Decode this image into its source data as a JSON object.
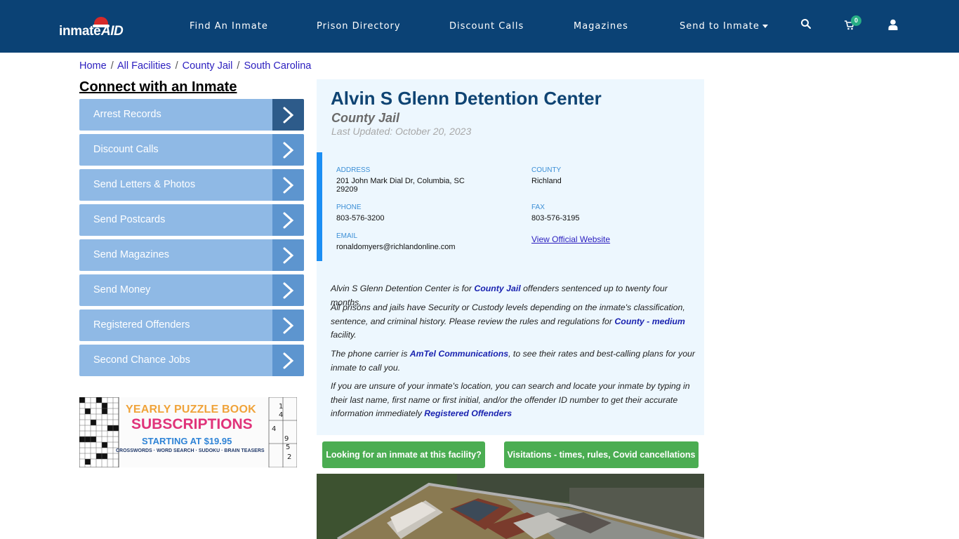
{
  "header": {
    "logo_text_1": "inmate",
    "logo_text_2": "AID",
    "nav": [
      {
        "label": "Find An Inmate"
      },
      {
        "label": "Prison Directory"
      },
      {
        "label": "Discount Calls"
      },
      {
        "label": "Magazines"
      },
      {
        "label": "Send to Inmate"
      }
    ],
    "cart_count": "0",
    "icons": [
      "search-icon",
      "cart-icon",
      "user-icon"
    ]
  },
  "breadcrumb": [
    {
      "label": "Home"
    },
    {
      "label": "All Facilities"
    },
    {
      "label": "County Jail"
    },
    {
      "label": "South Carolina"
    }
  ],
  "breadcrumb_sep": "/",
  "sidebar": {
    "title": "Connect with an Inmate",
    "items": [
      {
        "label": "Arrest Records"
      },
      {
        "label": "Discount Calls"
      },
      {
        "label": "Send Letters & Photos"
      },
      {
        "label": "Send Postcards"
      },
      {
        "label": "Send Magazines"
      },
      {
        "label": "Send Money"
      },
      {
        "label": "Registered Offenders"
      },
      {
        "label": "Second Chance Jobs"
      }
    ],
    "ad": {
      "line1": "YEARLY PUZZLE BOOK",
      "line2": "SUBSCRIPTIONS",
      "line3": "STARTING AT $19.95",
      "line4": "CROSSWORDS · WORD SEARCH · SUDOKU · BRAIN TEASERS"
    }
  },
  "facility": {
    "name": "Alvin S Glenn Detention Center",
    "type": "County Jail",
    "updated": "Last Updated: October 20, 2023",
    "address_label": "ADDRESS",
    "address_line1": "201 John Mark Dial Dr, Columbia, SC",
    "address_line2": "29209",
    "county_label": "COUNTY",
    "county": "Richland",
    "phone_label": "PHONE",
    "phone": "803-576-3200",
    "fax_label": "FAX",
    "fax": "803-576-3195",
    "email_label": "EMAIL",
    "email": "ronaldomyers@richlandonline.com",
    "website_link": "View Official Website"
  },
  "description": {
    "p1_a": "Alvin S Glenn Detention Center is for ",
    "p1_link": "County Jail",
    "p1_b": " offenders sentenced up to twenty four months.",
    "p2_a": "All prisons and jails have Security or Custody levels depending on the inmate's classification, sentence, and criminal history. Please review the rules and regulations for ",
    "p2_link": "County - medium",
    "p2_b": " facility.",
    "p3_a": "The phone carrier is ",
    "p3_link": "AmTel Communications",
    "p3_b": ", to see their rates and best-calling plans for your inmate to call you.",
    "p4_a": "If you are unsure of your inmate's location, you can search and locate your inmate by typing in their last name, first name or first initial, and/or the offender ID number to get their accurate information immediately ",
    "p4_link": "Registered Offenders"
  },
  "buttons": {
    "find_inmate": "Looking for an inmate at this facility?",
    "visitations": "Visitations - times, rules, Covid cancellations"
  },
  "colors": {
    "header_bg": "#0b4275",
    "sidebar_btn": "#8fb9e5",
    "green": "#4bad52",
    "title": "#0f4473"
  }
}
